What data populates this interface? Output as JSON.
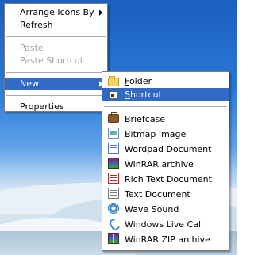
{
  "context_menu": {
    "items": [
      {
        "label": "Arrange Icons By",
        "has_submenu": true,
        "disabled": false
      },
      {
        "label": "Refresh",
        "disabled": false
      },
      {
        "label": "Paste",
        "disabled": true
      },
      {
        "label": "Paste Shortcut",
        "disabled": true
      },
      {
        "label": "New",
        "has_submenu": true,
        "highlighted": true
      },
      {
        "label": "Properties",
        "disabled": false
      }
    ]
  },
  "new_submenu": {
    "folder": {
      "mnemonic": "F",
      "rest": "older",
      "icon": "folder-icon"
    },
    "shortcut": {
      "mnemonic": "S",
      "rest": "hortcut",
      "icon": "shortcut-icon",
      "highlighted": true
    },
    "items": [
      {
        "label": "Briefcase",
        "icon": "briefcase-icon"
      },
      {
        "label": "Bitmap Image",
        "icon": "bitmap-image-icon"
      },
      {
        "label": "Wordpad Document",
        "icon": "wordpad-document-icon"
      },
      {
        "label": "WinRAR archive",
        "icon": "winrar-archive-icon"
      },
      {
        "label": "Rich Text Document",
        "icon": "rich-text-document-icon"
      },
      {
        "label": "Text Document",
        "icon": "text-document-icon"
      },
      {
        "label": "Wave Sound",
        "icon": "wave-sound-icon"
      },
      {
        "label": "Windows Live Call",
        "icon": "windows-live-call-icon"
      },
      {
        "label": "WinRAR ZIP archive",
        "icon": "winrar-zip-archive-icon"
      }
    ]
  },
  "colors": {
    "highlight": "#316ac5",
    "disabled_text": "#a0a0a0",
    "menu_background": "#ffffff"
  }
}
